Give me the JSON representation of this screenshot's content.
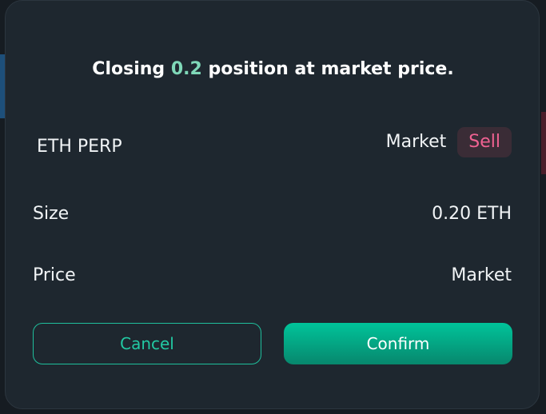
{
  "dialog": {
    "title_prefix": "Closing ",
    "title_amount": "0.2",
    "title_suffix": " position at market price.",
    "accent_color": "#7fd8b8"
  },
  "instrument": {
    "name": "ETH PERP",
    "order_type": "Market",
    "side": "Sell",
    "side_color": "#f06292"
  },
  "details": {
    "size_label": "Size",
    "size_value": "0.20 ETH",
    "price_label": "Price",
    "price_value": "Market"
  },
  "buttons": {
    "cancel_label": "Cancel",
    "confirm_label": "Confirm",
    "confirm_color": "#00c49a"
  }
}
